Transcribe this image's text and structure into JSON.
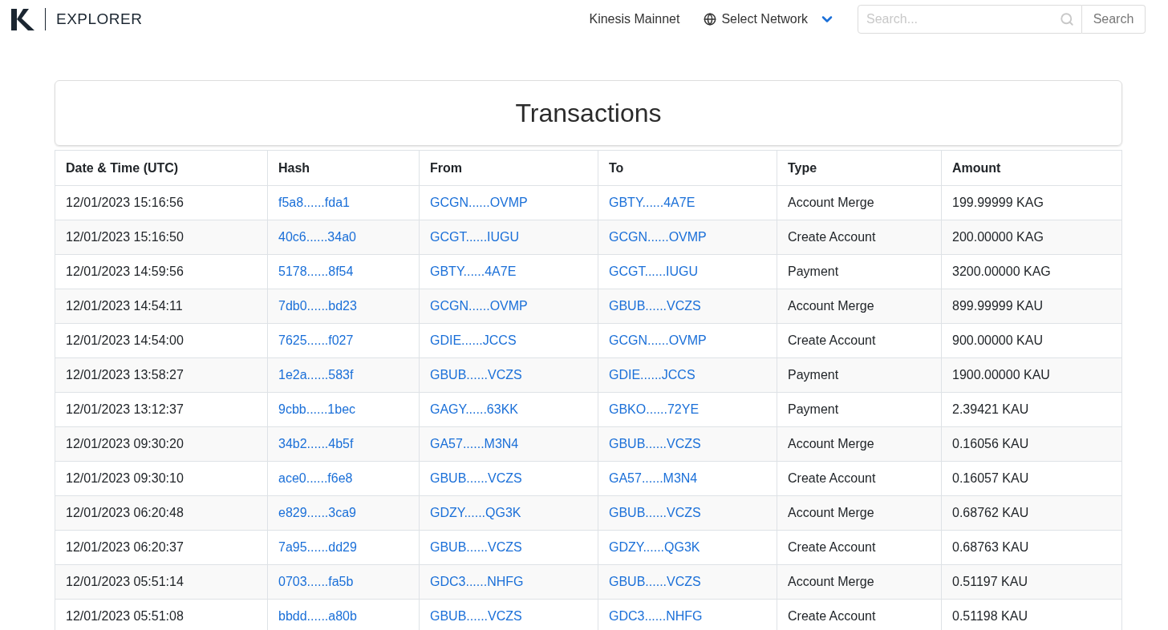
{
  "header": {
    "logo_text": "EXPLORER",
    "network_name": "Kinesis Mainnet",
    "network_selector": "Select Network",
    "search": {
      "placeholder": "Search..."
    },
    "search_button": "Search"
  },
  "title": "Transactions",
  "table": {
    "columns": [
      "Date & Time (UTC)",
      "Hash",
      "From",
      "To",
      "Type",
      "Amount"
    ],
    "rows": [
      {
        "datetime": "12/01/2023 15:16:56",
        "hash": "f5a8......fda1",
        "from": "GCGN......OVMP",
        "to": "GBTY......4A7E",
        "type": "Account Merge",
        "amount": "199.99999 KAG"
      },
      {
        "datetime": "12/01/2023 15:16:50",
        "hash": "40c6......34a0",
        "from": "GCGT......IUGU",
        "to": "GCGN......OVMP",
        "type": "Create Account",
        "amount": "200.00000 KAG"
      },
      {
        "datetime": "12/01/2023 14:59:56",
        "hash": "5178......8f54",
        "from": "GBTY......4A7E",
        "to": "GCGT......IUGU",
        "type": "Payment",
        "amount": "3200.00000 KAG"
      },
      {
        "datetime": "12/01/2023 14:54:11",
        "hash": "7db0......bd23",
        "from": "GCGN......OVMP",
        "to": "GBUB......VCZS",
        "type": "Account Merge",
        "amount": "899.99999 KAU"
      },
      {
        "datetime": "12/01/2023 14:54:00",
        "hash": "7625......f027",
        "from": "GDIE......JCCS",
        "to": "GCGN......OVMP",
        "type": "Create Account",
        "amount": "900.00000 KAU"
      },
      {
        "datetime": "12/01/2023 13:58:27",
        "hash": "1e2a......583f",
        "from": "GBUB......VCZS",
        "to": "GDIE......JCCS",
        "type": "Payment",
        "amount": "1900.00000 KAU"
      },
      {
        "datetime": "12/01/2023 13:12:37",
        "hash": "9cbb......1bec",
        "from": "GAGY......63KK",
        "to": "GBKO......72YE",
        "type": "Payment",
        "amount": "2.39421 KAU"
      },
      {
        "datetime": "12/01/2023 09:30:20",
        "hash": "34b2......4b5f",
        "from": "GA57......M3N4",
        "to": "GBUB......VCZS",
        "type": "Account Merge",
        "amount": "0.16056 KAU"
      },
      {
        "datetime": "12/01/2023 09:30:10",
        "hash": "ace0......f6e8",
        "from": "GBUB......VCZS",
        "to": "GA57......M3N4",
        "type": "Create Account",
        "amount": "0.16057 KAU"
      },
      {
        "datetime": "12/01/2023 06:20:48",
        "hash": "e829......3ca9",
        "from": "GDZY......QG3K",
        "to": "GBUB......VCZS",
        "type": "Account Merge",
        "amount": "0.68762 KAU"
      },
      {
        "datetime": "12/01/2023 06:20:37",
        "hash": "7a95......dd29",
        "from": "GBUB......VCZS",
        "to": "GDZY......QG3K",
        "type": "Create Account",
        "amount": "0.68763 KAU"
      },
      {
        "datetime": "12/01/2023 05:51:14",
        "hash": "0703......fa5b",
        "from": "GDC3......NHFG",
        "to": "GBUB......VCZS",
        "type": "Account Merge",
        "amount": "0.51197 KAU"
      },
      {
        "datetime": "12/01/2023 05:51:08",
        "hash": "bbdd......a80b",
        "from": "GBUB......VCZS",
        "to": "GDC3......NHFG",
        "type": "Create Account",
        "amount": "0.51198 KAU"
      }
    ]
  }
}
